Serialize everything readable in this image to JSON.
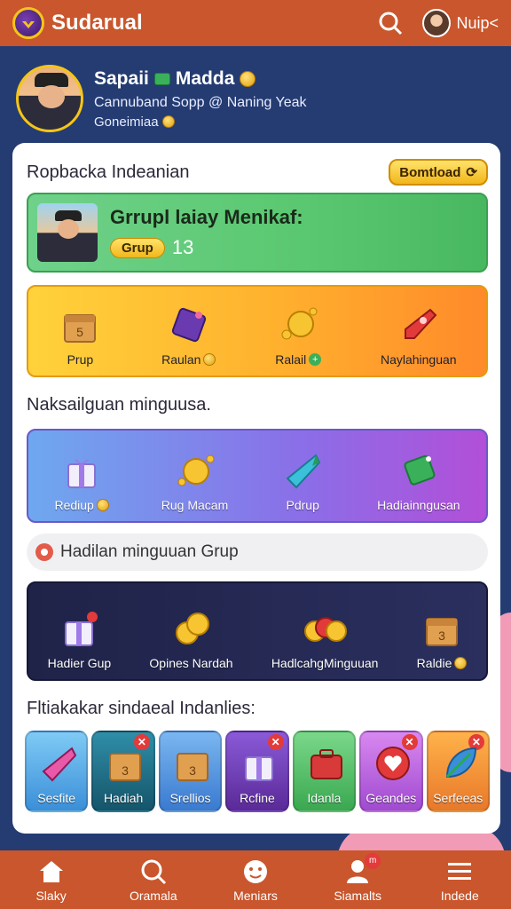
{
  "app": {
    "title": "Sudarual",
    "user": "Nuip<"
  },
  "profile": {
    "name": "Sapaii",
    "name_suffix": "Madda",
    "subtitle": "Cannuband Sopp @ Naning Yeak",
    "subtitle2": "Goneimiaa"
  },
  "card": {
    "title": "Ropbacka Indeanian",
    "download_label": "Bomtload",
    "banner": {
      "title": "Grrupl laiay Menikaf:",
      "pill": "Grup",
      "count": "13"
    },
    "row1": [
      {
        "label": "Prup",
        "icon": "box-icon"
      },
      {
        "label": "Raulan",
        "icon": "tag-icon"
      },
      {
        "label": "Ralail",
        "icon": "coins-icon"
      },
      {
        "label": "Naylahinguan",
        "icon": "rocket-icon"
      }
    ],
    "section1": "Naksailguan minguusa.",
    "row2": [
      {
        "label": "Rediup",
        "icon": "gift-icon"
      },
      {
        "label": "Rug Macam",
        "icon": "coins-icon"
      },
      {
        "label": "Pdrup",
        "icon": "crystal-icon"
      },
      {
        "label": "Hadiainngusan",
        "icon": "tag-icon"
      }
    ],
    "search_text": "Hadilan minguuan Grup",
    "row3": [
      {
        "label": "Hadier Gup",
        "icon": "gift-icon"
      },
      {
        "label": "Opines Nardah",
        "icon": "coins-icon"
      },
      {
        "label": "HadlcahgMinguuan",
        "icon": "coins-icon"
      },
      {
        "label": "Raldie",
        "icon": "box-icon"
      }
    ],
    "section2": "Fltiakakar sindaeal Indanlies:",
    "strip": [
      {
        "label": "Sesfite",
        "color": "#4aa7e8",
        "icon": "crystal-icon"
      },
      {
        "label": "Hadiah",
        "color": "#1f6f8a",
        "icon": "box-icon"
      },
      {
        "label": "Srellios",
        "color": "#4f96d8",
        "icon": "box-icon"
      },
      {
        "label": "Rcfine",
        "color": "#6a3aa8",
        "icon": "gift-icon"
      },
      {
        "label": "Idanla",
        "color": "#4fbf5f",
        "icon": "bag-icon"
      },
      {
        "label": "Geandes",
        "color": "#b35ad8",
        "icon": "heart-icon"
      },
      {
        "label": "Serfeeas",
        "color": "#ef8a2a",
        "icon": "leaf-icon"
      }
    ]
  },
  "nav": [
    {
      "label": "Slaky",
      "icon": "home-icon"
    },
    {
      "label": "Oramala",
      "icon": "search-icon"
    },
    {
      "label": "Meniars",
      "icon": "face-icon"
    },
    {
      "label": "Siamalts",
      "icon": "user-icon",
      "badge": "m"
    },
    {
      "label": "Indede",
      "icon": "menu-icon"
    }
  ]
}
